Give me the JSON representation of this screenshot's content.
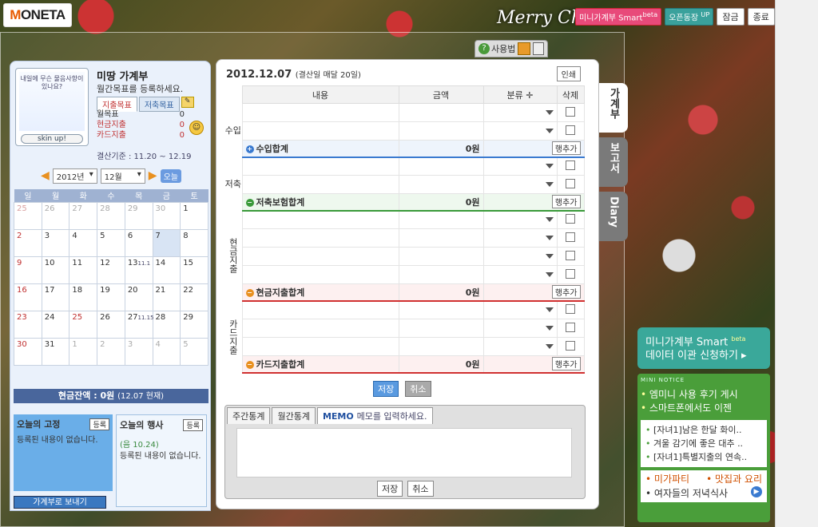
{
  "brand": {
    "logo_accent": "M",
    "logo_rest": "ONETA",
    "banner": "Merry Christmas"
  },
  "topbar": {
    "smart_label": "미니가계부 Smart",
    "smart_badge": "beta",
    "open_label": "오픈동장",
    "open_badge": "UP",
    "lock_label": "잠금",
    "exit_label": "종료"
  },
  "tools": {
    "help_label": "사용법"
  },
  "profile": {
    "art_text": "내일에 무슨 물음사항이 있나요?",
    "skin_button": "skin up!",
    "name": "미땅 가계부",
    "desc": "월간목표를 등록하세요.",
    "tabs": [
      "지출목표",
      "저축목표"
    ],
    "goals": [
      {
        "label": "월목표",
        "value": "0"
      },
      {
        "label": "현금지출",
        "value": "0"
      },
      {
        "label": "카드지출",
        "value": "0"
      }
    ],
    "settle": "결산기준 : 11.20 ~ 12.19"
  },
  "calendar": {
    "year": "2012년",
    "month": "12월",
    "today_btn": "오늘",
    "weekdays": [
      "일",
      "월",
      "화",
      "수",
      "목",
      "금",
      "토"
    ],
    "weeks": [
      [
        "25",
        "26",
        "27",
        "28",
        "29",
        "30",
        "1"
      ],
      [
        "2",
        "3",
        "4",
        "5",
        "6",
        "7",
        "8"
      ],
      [
        "9",
        "10",
        "11",
        "12",
        "13",
        "14",
        "15"
      ],
      [
        "16",
        "17",
        "18",
        "19",
        "20",
        "21",
        "22"
      ],
      [
        "23",
        "24",
        "25",
        "26",
        "27",
        "28",
        "29"
      ],
      [
        "30",
        "31",
        "1",
        "2",
        "3",
        "4",
        "5"
      ]
    ],
    "note_13": "11.1",
    "note_27": "11.15"
  },
  "cash": {
    "label": "현금잔액 : 0원",
    "sub": "(12.07 현재)"
  },
  "fixed": {
    "title": "오늘의 고정",
    "btn": "등록",
    "text": "등록된 내용이 없습니다."
  },
  "event": {
    "title": "오늘의 행사",
    "btn": "등록",
    "date": "(음 10.24)",
    "text": "등록된 내용이 없습니다."
  },
  "send_btn": "가계부로 보내기",
  "ledger": {
    "date": "2012.12.07",
    "date_note": "(결산일 매달 20일)",
    "print": "인쇄",
    "headers": [
      "내용",
      "금액",
      "분류",
      "삭제"
    ],
    "sections": [
      {
        "cat": "수입",
        "sum_label": "수입합계",
        "amount": "0원",
        "add": "행추가"
      },
      {
        "cat": "저축",
        "sum_label": "저축보험합계",
        "amount": "0원",
        "add": "행추가"
      },
      {
        "cat": "현금지출",
        "sum_label": "현금지출합계",
        "amount": "0원",
        "add": "행추가"
      },
      {
        "cat": "카드지출",
        "sum_label": "카드지출합계",
        "amount": "0원",
        "add": "행추가"
      }
    ],
    "save": "저장",
    "cancel": "취소"
  },
  "memo": {
    "tab_weekly": "주간통계",
    "tab_monthly": "월간통계",
    "tab_memo": "MEMO",
    "memo_hint": "메모를 입력하세요.",
    "save": "저장",
    "cancel": "취소"
  },
  "sidetabs": [
    "가계부",
    "보고서",
    "Diary"
  ],
  "promo": {
    "line1": "미니가계부 Smart",
    "badge": "beta",
    "line2": "데이터 이관 신청하기"
  },
  "notice": {
    "head": "MINI NOTICE",
    "top": [
      "엠미니 사용 후기 게시",
      "스마트폰에서도 이젠"
    ],
    "items": [
      "[자녀1]남은 한달 화이..",
      "겨울 감기에 좋은 대추 ..",
      "[자녀1]특별지출의 연속.."
    ],
    "links": [
      "미가파티",
      "맛집과 요리",
      "여자들의 저녁식사"
    ]
  }
}
